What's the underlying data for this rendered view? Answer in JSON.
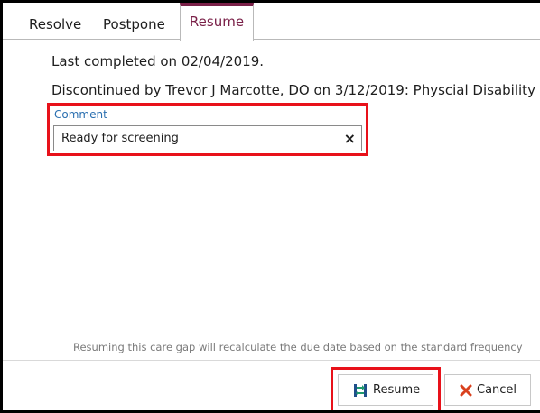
{
  "tabs": [
    {
      "label": "Resolve",
      "active": false
    },
    {
      "label": "Postpone",
      "active": false
    },
    {
      "label": "Resume",
      "active": true
    }
  ],
  "info": {
    "last_completed": "Last completed on 02/04/2019.",
    "discontinued": "Discontinued by Trevor J Marcotte, DO on 3/12/2019: Physcial Disability"
  },
  "comment": {
    "label": "Comment",
    "value": "Ready for screening",
    "clear_glyph": "×"
  },
  "note": "Resuming this care gap will recalculate the due date based on the standard frequency",
  "buttons": {
    "resume": {
      "label": "Resume",
      "icon": "resume-arrows-icon"
    },
    "cancel": {
      "label": "Cancel",
      "icon": "x-icon"
    }
  },
  "colors": {
    "accent_tab": "#7a2048",
    "highlight": "#e8111a",
    "label_blue": "#2a6fb0",
    "resume_icon": "#1f9a6e",
    "cancel_icon": "#d9411e"
  }
}
